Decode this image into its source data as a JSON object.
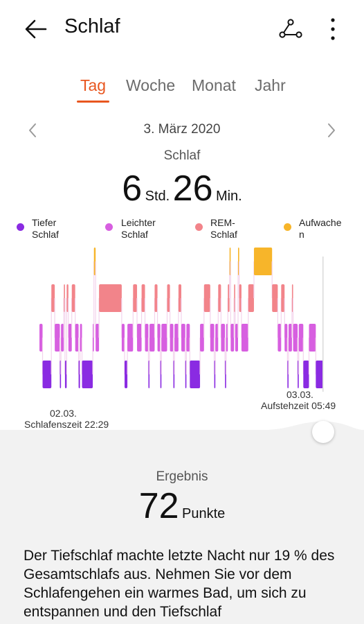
{
  "header": {
    "title": "Schlaf",
    "back_icon": "arrow-left-icon",
    "share_icon": "share-icon",
    "more_icon": "more-vertical-icon"
  },
  "tabs": [
    {
      "label": "Tag",
      "active": true
    },
    {
      "label": "Woche",
      "active": false
    },
    {
      "label": "Monat",
      "active": false
    },
    {
      "label": "Jahr",
      "active": false
    }
  ],
  "date_nav": {
    "date": "3. März 2020",
    "prev_icon": "chevron-left-icon",
    "next_icon": "chevron-right-icon"
  },
  "summary": {
    "label": "Schlaf",
    "hours": "6",
    "hours_unit": "Std.",
    "minutes": "26",
    "minutes_unit": "Min."
  },
  "legend": [
    {
      "line1": "Tiefer",
      "line2": "Schlaf",
      "color": "#8a2be2"
    },
    {
      "line1": "Leichter",
      "line2": "Schlaf",
      "color": "#d75fe0"
    },
    {
      "line1": "REM-",
      "line2": "Schlaf",
      "color": "#f2848a"
    },
    {
      "line1": "Aufwache",
      "line2": "n",
      "color": "#f7b52a"
    }
  ],
  "chart_data": {
    "type": "hypnogram",
    "stages": [
      "Aufwachen",
      "REM-Schlaf",
      "Leichter Schlaf",
      "Tiefer Schlaf"
    ],
    "colors": {
      "Aufwachen": "#f7b52a",
      "REM-Schlaf": "#f2848a",
      "Leichter Schlaf": "#d75fe0",
      "Tiefer Schlaf": "#8a2be2"
    },
    "start_label": {
      "line1": "02.03.",
      "line2": "Schlafenszeit 22:29"
    },
    "end_label": {
      "line1": "03.03.",
      "line2": "Aufstehzeit 05:49"
    },
    "segments": [
      {
        "from": 0.0,
        "to": 1.1,
        "stage": "Leichter Schlaf"
      },
      {
        "from": 1.1,
        "to": 4.2,
        "stage": "Tiefer Schlaf"
      },
      {
        "from": 4.2,
        "to": 5.4,
        "stage": "REM-Schlaf"
      },
      {
        "from": 5.4,
        "to": 7.2,
        "stage": "Leichter Schlaf"
      },
      {
        "from": 7.2,
        "to": 7.6,
        "stage": "Tiefer Schlaf"
      },
      {
        "from": 7.6,
        "to": 8.6,
        "stage": "Leichter Schlaf"
      },
      {
        "from": 8.6,
        "to": 9.0,
        "stage": "REM-Schlaf"
      },
      {
        "from": 9.0,
        "to": 9.6,
        "stage": "Tiefer Schlaf"
      },
      {
        "from": 9.6,
        "to": 10.2,
        "stage": "REM-Schlaf"
      },
      {
        "from": 10.2,
        "to": 11.4,
        "stage": "Leichter Schlaf"
      },
      {
        "from": 11.4,
        "to": 12.6,
        "stage": "REM-Schlaf"
      },
      {
        "from": 12.6,
        "to": 13.8,
        "stage": "Leichter Schlaf"
      },
      {
        "from": 13.8,
        "to": 14.3,
        "stage": "Tiefer Schlaf"
      },
      {
        "from": 14.3,
        "to": 15.0,
        "stage": "Leichter Schlaf"
      },
      {
        "from": 15.0,
        "to": 18.8,
        "stage": "Tiefer Schlaf"
      },
      {
        "from": 18.8,
        "to": 19.2,
        "stage": "Leichter Schlaf"
      },
      {
        "from": 19.2,
        "to": 19.8,
        "stage": "Aufwachen"
      },
      {
        "from": 19.8,
        "to": 21.0,
        "stage": "Leichter Schlaf"
      },
      {
        "from": 21.0,
        "to": 29.0,
        "stage": "REM-Schlaf"
      },
      {
        "from": 29.0,
        "to": 30.0,
        "stage": "Leichter Schlaf"
      },
      {
        "from": 30.0,
        "to": 31.0,
        "stage": "Tiefer Schlaf"
      },
      {
        "from": 31.0,
        "to": 33.0,
        "stage": "Leichter Schlaf"
      },
      {
        "from": 33.0,
        "to": 34.4,
        "stage": "REM-Schlaf"
      },
      {
        "from": 34.4,
        "to": 36.0,
        "stage": "Leichter Schlaf"
      },
      {
        "from": 36.0,
        "to": 37.2,
        "stage": "REM-Schlaf"
      },
      {
        "from": 37.2,
        "to": 38.4,
        "stage": "Leichter Schlaf"
      },
      {
        "from": 38.4,
        "to": 38.8,
        "stage": "Tiefer Schlaf"
      },
      {
        "from": 38.8,
        "to": 40.6,
        "stage": "Leichter Schlaf"
      },
      {
        "from": 40.6,
        "to": 41.6,
        "stage": "REM-Schlaf"
      },
      {
        "from": 41.6,
        "to": 42.6,
        "stage": "Leichter Schlaf"
      },
      {
        "from": 42.6,
        "to": 43.0,
        "stage": "Tiefer Schlaf"
      },
      {
        "from": 43.0,
        "to": 45.0,
        "stage": "Leichter Schlaf"
      },
      {
        "from": 45.0,
        "to": 46.0,
        "stage": "REM-Schlaf"
      },
      {
        "from": 46.0,
        "to": 47.2,
        "stage": "Leichter Schlaf"
      },
      {
        "from": 47.2,
        "to": 47.6,
        "stage": "Tiefer Schlaf"
      },
      {
        "from": 47.6,
        "to": 49.0,
        "stage": "Leichter Schlaf"
      },
      {
        "from": 49.0,
        "to": 50.0,
        "stage": "REM-Schlaf"
      },
      {
        "from": 50.0,
        "to": 51.4,
        "stage": "Leichter Schlaf"
      },
      {
        "from": 51.4,
        "to": 51.8,
        "stage": "Tiefer Schlaf"
      },
      {
        "from": 51.8,
        "to": 53.0,
        "stage": "Leichter Schlaf"
      },
      {
        "from": 53.0,
        "to": 56.6,
        "stage": "Tiefer Schlaf"
      },
      {
        "from": 56.6,
        "to": 58.0,
        "stage": "Leichter Schlaf"
      },
      {
        "from": 58.0,
        "to": 60.2,
        "stage": "REM-Schlaf"
      },
      {
        "from": 60.2,
        "to": 61.6,
        "stage": "Leichter Schlaf"
      },
      {
        "from": 61.6,
        "to": 62.0,
        "stage": "Tiefer Schlaf"
      },
      {
        "from": 62.0,
        "to": 63.0,
        "stage": "Leichter Schlaf"
      },
      {
        "from": 63.0,
        "to": 64.0,
        "stage": "REM-Schlaf"
      },
      {
        "from": 64.0,
        "to": 65.4,
        "stage": "Leichter Schlaf"
      },
      {
        "from": 65.4,
        "to": 65.8,
        "stage": "Tiefer Schlaf"
      },
      {
        "from": 65.8,
        "to": 66.4,
        "stage": "Leichter Schlaf"
      },
      {
        "from": 66.4,
        "to": 67.0,
        "stage": "REM-Schlaf"
      },
      {
        "from": 67.0,
        "to": 67.4,
        "stage": "Aufwachen"
      },
      {
        "from": 67.4,
        "to": 68.6,
        "stage": "Leichter Schlaf"
      },
      {
        "from": 68.6,
        "to": 69.0,
        "stage": "REM-Schlaf"
      },
      {
        "from": 69.0,
        "to": 70.0,
        "stage": "Leichter Schlaf"
      },
      {
        "from": 70.0,
        "to": 70.4,
        "stage": "Aufwachen"
      },
      {
        "from": 70.4,
        "to": 71.2,
        "stage": "REM-Schlaf"
      },
      {
        "from": 71.2,
        "to": 73.6,
        "stage": "Leichter Schlaf"
      },
      {
        "from": 73.6,
        "to": 75.6,
        "stage": "REM-Schlaf"
      },
      {
        "from": 75.6,
        "to": 82.0,
        "stage": "Aufwachen"
      },
      {
        "from": 82.0,
        "to": 84.0,
        "stage": "REM-Schlaf"
      },
      {
        "from": 84.0,
        "to": 85.2,
        "stage": "Leichter Schlaf"
      },
      {
        "from": 85.2,
        "to": 86.4,
        "stage": "REM-Schlaf"
      },
      {
        "from": 86.4,
        "to": 87.4,
        "stage": "Leichter Schlaf"
      },
      {
        "from": 87.4,
        "to": 87.8,
        "stage": "Tiefer Schlaf"
      },
      {
        "from": 87.8,
        "to": 89.0,
        "stage": "Leichter Schlaf"
      },
      {
        "from": 89.0,
        "to": 89.4,
        "stage": "REM-Schlaf"
      },
      {
        "from": 89.4,
        "to": 91.0,
        "stage": "Leichter Schlaf"
      },
      {
        "from": 91.0,
        "to": 91.4,
        "stage": "Tiefer Schlaf"
      },
      {
        "from": 91.4,
        "to": 93.0,
        "stage": "Leichter Schlaf"
      },
      {
        "from": 93.0,
        "to": 95.0,
        "stage": "Tiefer Schlaf"
      },
      {
        "from": 95.0,
        "to": 97.4,
        "stage": "Leichter Schlaf"
      },
      {
        "from": 97.4,
        "to": 100.0,
        "stage": "Tiefer Schlaf"
      }
    ]
  },
  "result": {
    "label": "Ergebnis",
    "score": "72",
    "unit": "Punkte"
  },
  "advice": "Der Tiefschlaf machte letzte Nacht nur 19 % des Gesamtschlafs aus. Nehmen Sie vor dem Schlafengehen ein warmes Bad, um sich zu entspannen und den Tiefschlaf"
}
